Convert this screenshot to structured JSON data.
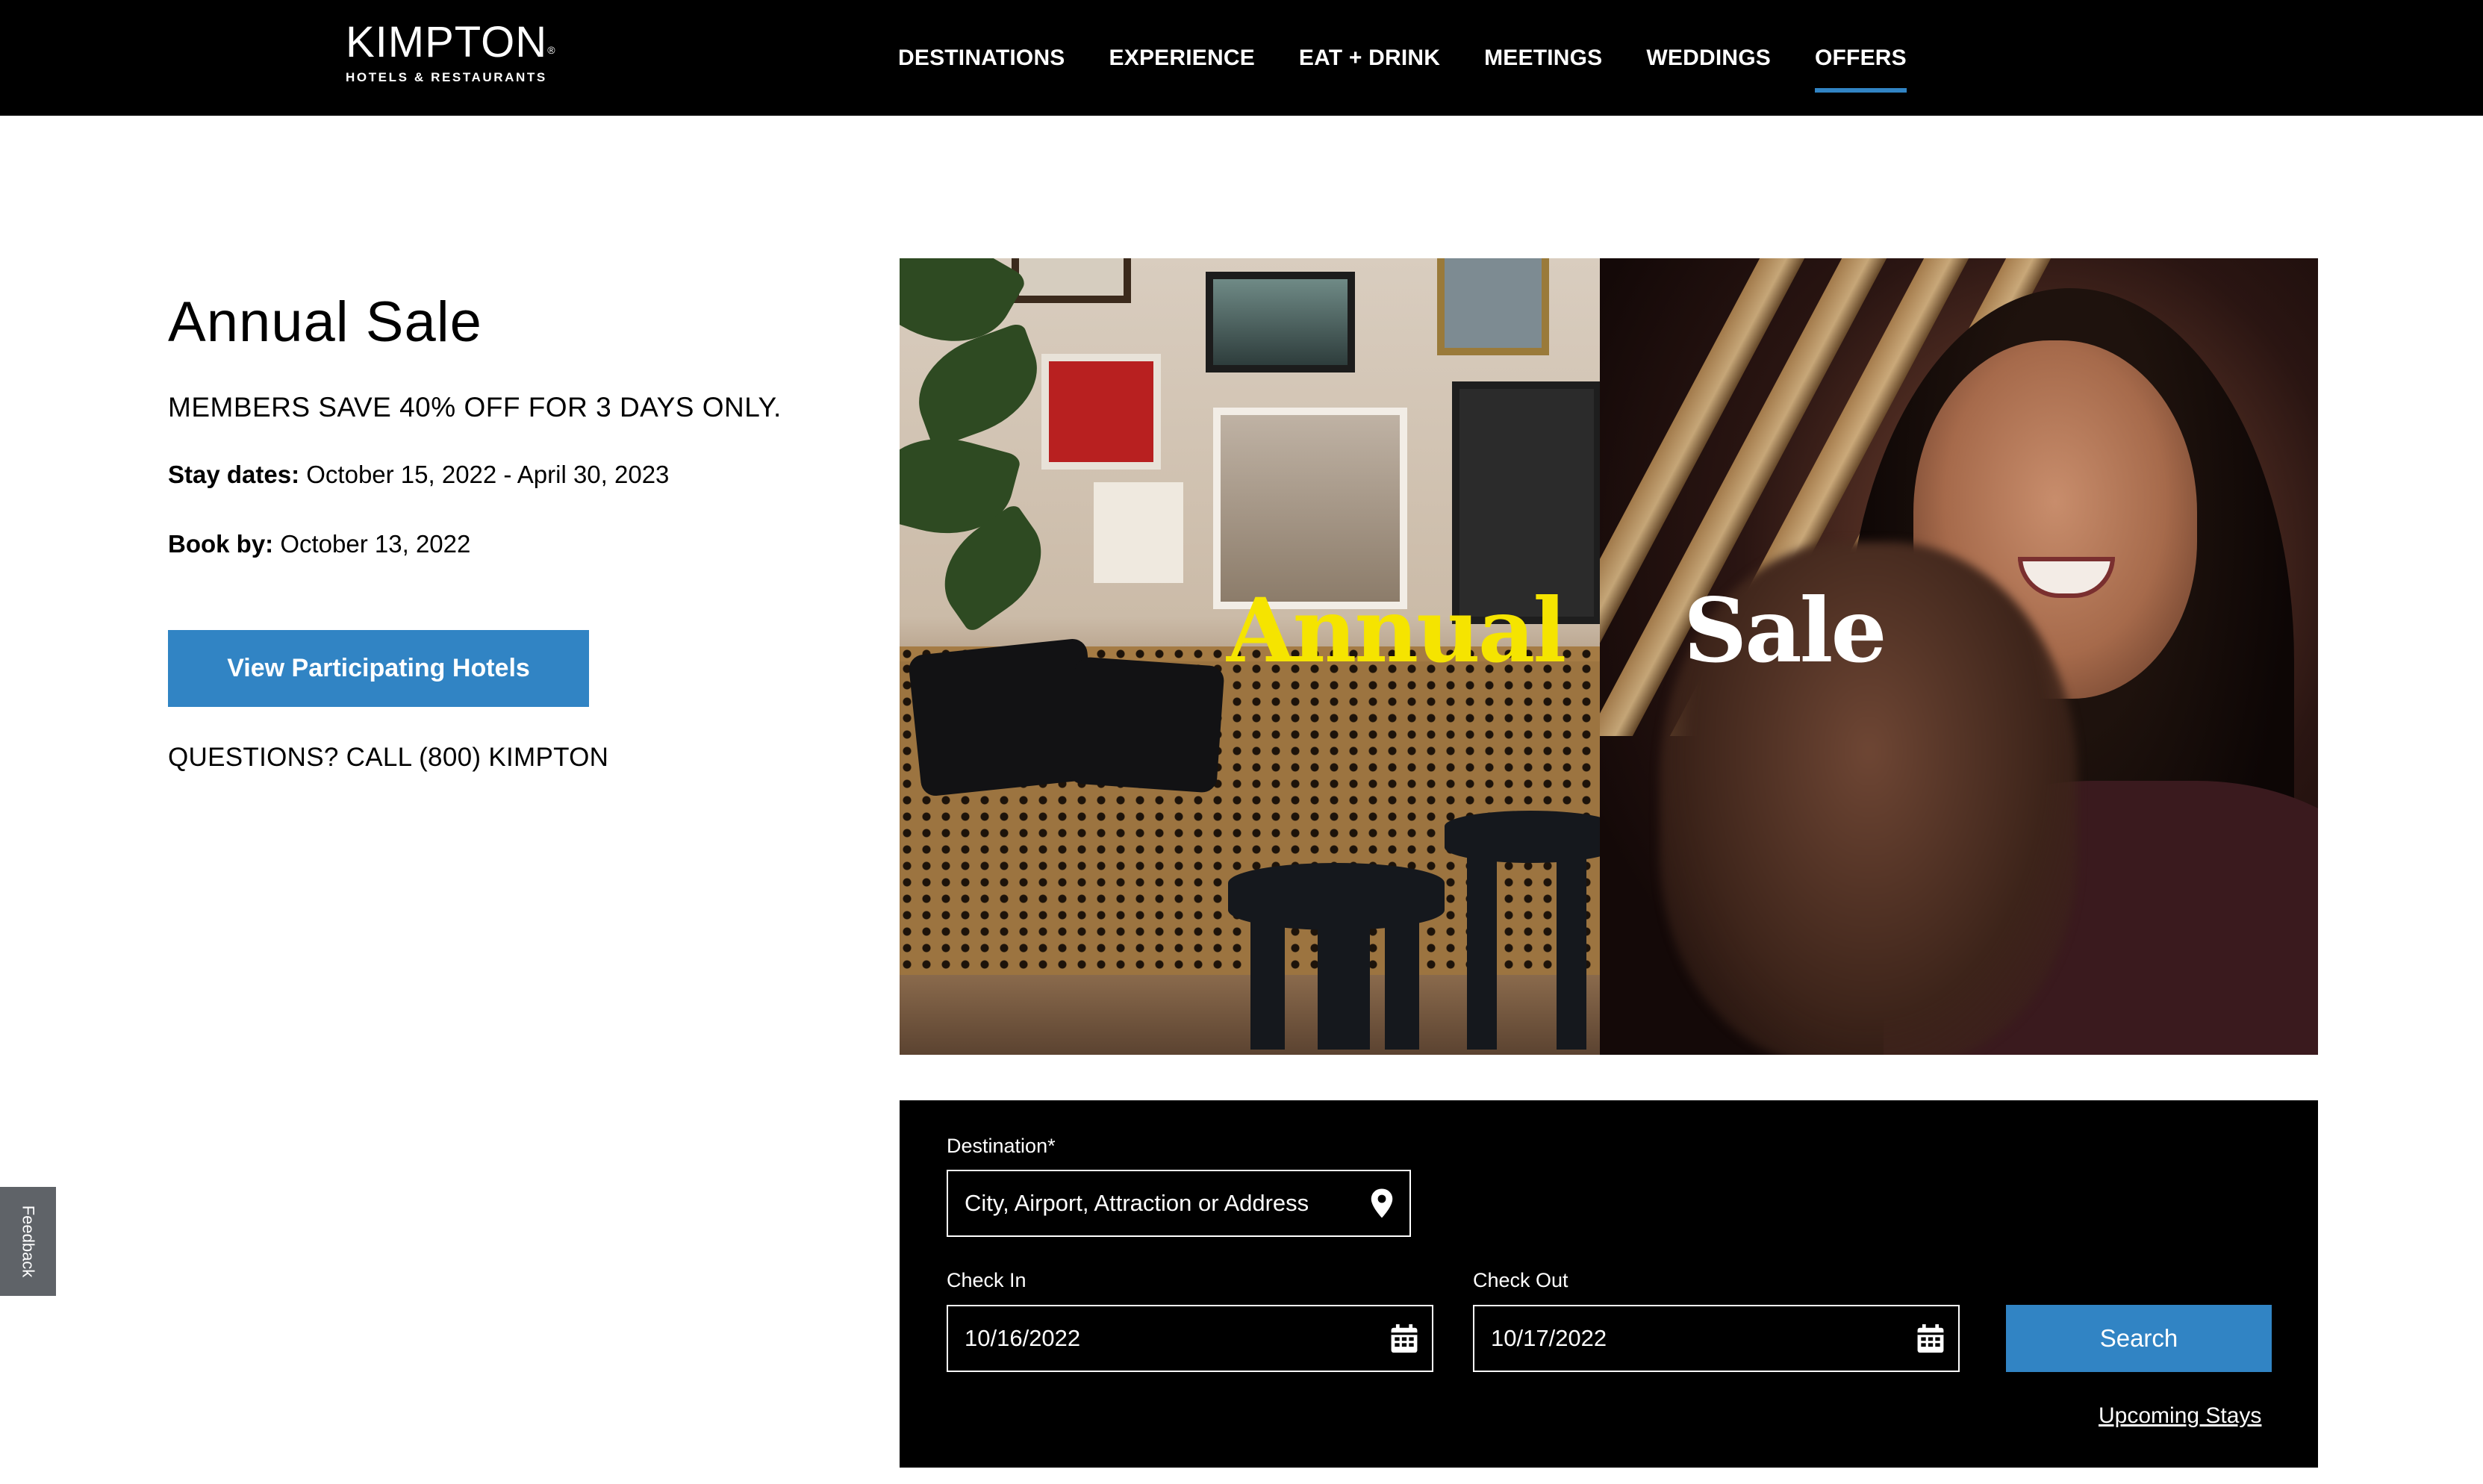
{
  "brand": {
    "name": "KIMPTON",
    "mark": "®",
    "tagline": "HOTELS & RESTAURANTS"
  },
  "nav": {
    "items": [
      {
        "label": "DESTINATIONS",
        "active": false
      },
      {
        "label": "EXPERIENCE",
        "active": false
      },
      {
        "label": "EAT + DRINK",
        "active": false
      },
      {
        "label": "MEETINGS",
        "active": false
      },
      {
        "label": "WEDDINGS",
        "active": false
      },
      {
        "label": "OFFERS",
        "active": true
      }
    ]
  },
  "offer": {
    "title": "Annual Sale",
    "subtitle": "MEMBERS SAVE 40% OFF FOR 3 DAYS ONLY.",
    "stay_label": "Stay dates:",
    "stay_value": "October 15, 2022 - April 30, 2023",
    "book_label": "Book by:",
    "book_value": "October 13, 2022",
    "cta_label": "View Participating Hotels",
    "questions": "QUESTIONS? CALL (800) KIMPTON"
  },
  "hero": {
    "word_left": "Annual",
    "word_right": "Sale"
  },
  "booking": {
    "destination_label": "Destination*",
    "destination_placeholder": "City, Airport, Attraction or Address",
    "checkin_label": "Check In",
    "checkin_value": "10/16/2022",
    "checkout_label": "Check Out",
    "checkout_value": "10/17/2022",
    "search_label": "Search",
    "upcoming_label": "Upcoming Stays"
  },
  "feedback": {
    "label": "Feedback"
  },
  "colors": {
    "accent": "#3184c4",
    "header_bg": "#000000",
    "annual_yellow": "#f5e400"
  },
  "icons": {
    "destination": "map-pin-icon",
    "calendar": "calendar-icon"
  }
}
